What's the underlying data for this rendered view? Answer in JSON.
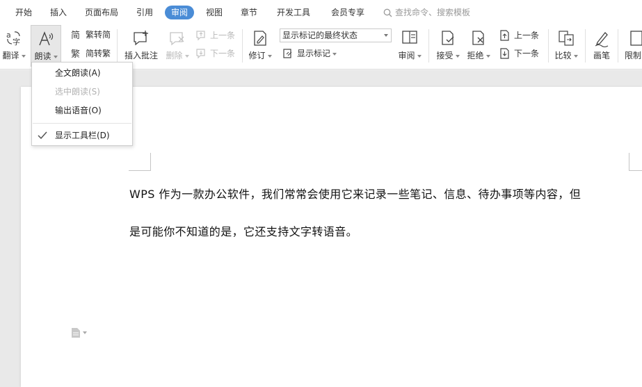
{
  "tabs": [
    {
      "label": "开始"
    },
    {
      "label": "插入"
    },
    {
      "label": "页面布局"
    },
    {
      "label": "引用"
    },
    {
      "label": "审阅",
      "active": true
    },
    {
      "label": "视图"
    },
    {
      "label": "章节"
    },
    {
      "label": "开发工具"
    },
    {
      "label": "会员专享"
    }
  ],
  "search": {
    "placeholder": "查找命令、搜索模板"
  },
  "ribbon": {
    "translate": "翻译",
    "read_aloud": "朗读",
    "trad_to_simp": "繁转简",
    "simp_to_trad": "简转繁",
    "insert_comment": "插入批注",
    "delete": "删除",
    "prev_comment": "上一条",
    "next_comment": "下一条",
    "track_changes": "修订",
    "markup_select": "显示标记的最终状态",
    "show_markup": "显示标记",
    "review": "审阅",
    "accept": "接受",
    "reject": "拒绝",
    "prev_change": "上一条",
    "next_change": "下一条",
    "compare": "比较",
    "pen": "画笔",
    "restrict": "限制"
  },
  "read_menu": {
    "items": [
      {
        "label": "全文朗读(A)",
        "enabled": true
      },
      {
        "label": "选中朗读(S)",
        "enabled": false
      },
      {
        "label": "输出语音(O)",
        "enabled": true
      },
      {
        "label": "显示工具栏(D)",
        "enabled": true,
        "checked": true
      }
    ]
  },
  "document": {
    "paragraph1": "WPS 作为一款办公软件，我们常常会使用它来记录一些笔记、信息、待办事项等内容，但",
    "paragraph2": "是可能你不知道的是，它还支持文字转语音。"
  },
  "colors": {
    "accent": "#4a8cd6",
    "disabled": "#b8b8b8"
  }
}
